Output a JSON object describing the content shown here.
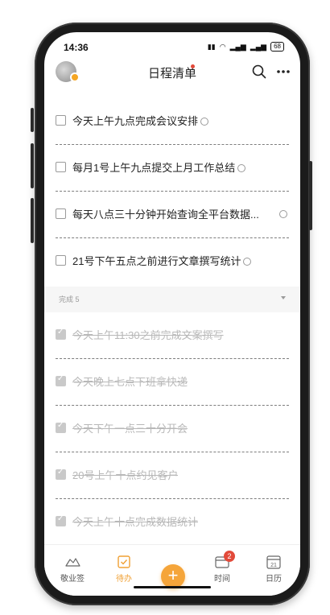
{
  "status_bar": {
    "time": "14:36",
    "battery": "68"
  },
  "header": {
    "title": "日程清单",
    "avatar_icon": "user-avatar",
    "search_icon": "search-icon",
    "more_icon": "more-horizontal-icon"
  },
  "tasks": [
    {
      "text": "今天上午九点完成会议安排",
      "done": false,
      "icon": "clock-icon"
    },
    {
      "text": "每月1号上午九点提交上月工作总结",
      "done": false,
      "icon": "clock-icon"
    },
    {
      "text": "每天八点三十分钟开始查询全平台数据...",
      "done": false,
      "icon": "clock-icon"
    },
    {
      "text": "21号下午五点之前进行文章撰写统计",
      "done": false,
      "icon": "clock-icon"
    }
  ],
  "done_section": {
    "label": "完成 5",
    "items": [
      {
        "text": "今天上午11:30之前完成文案撰写"
      },
      {
        "text": "今天晚上七点下班拿快递"
      },
      {
        "text": "今天下午一点三十分开会"
      },
      {
        "text": "20号上午十点约见客户"
      },
      {
        "text": "今天上午十点完成数据统计"
      }
    ]
  },
  "tabbar": {
    "tabs": [
      {
        "label": "敬业签",
        "icon": "cloud-icon"
      },
      {
        "label": "待办",
        "icon": "todo-check-icon",
        "active": true
      },
      {
        "label": "时间",
        "icon": "time-calendar-icon",
        "badge": "2"
      },
      {
        "label": "日历",
        "icon": "calendar-icon",
        "date": "21"
      }
    ],
    "add_label": "+"
  },
  "colors": {
    "accent": "#f5a53a",
    "badge": "#e24a3a"
  }
}
